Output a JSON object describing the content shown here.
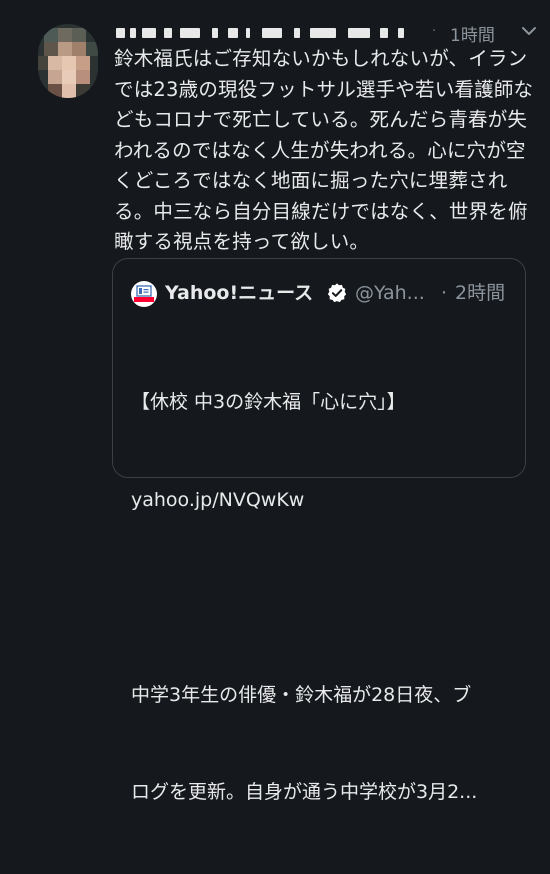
{
  "tweet": {
    "author_name": "",
    "separator": "·",
    "timestamp": "1時間",
    "text": "鈴木福氏はご存知ないかもしれないが、イランでは23歳の現役フットサル選手や若い看護師などもコロナで死亡している。死んだら青春が失われるのではなく人生が失われる。心に穴が空くどころではなく地面に掘った穴に埋葬される。中三なら自分目線だけではなく、世界を俯瞰する視点を持って欲しい。"
  },
  "quote": {
    "author_name": "Yahoo!ニュース",
    "handle": "@Yah...",
    "separator": "·",
    "timestamp": "2時間",
    "text_lines": [
      "【休校 中3の鈴木福「心に穴」】",
      "yahoo.jp/NVQwKw",
      "",
      "中学3年生の俳優・鈴木福が28日夜、ブ",
      "ログを更新。自身が通う中学校が3月2..."
    ]
  },
  "colors": {
    "background": "#15181c",
    "text": "#e7e9ea",
    "secondary_text": "#8b949c",
    "border": "#3a4047",
    "verified": "#ffffff",
    "yahoo_brand": "#ff0033"
  },
  "icons": {
    "avatar": "pixelated-avatar",
    "caret": "chevron-down-icon",
    "verified": "verified-badge-icon",
    "logo": "yahoo-news-logo"
  }
}
